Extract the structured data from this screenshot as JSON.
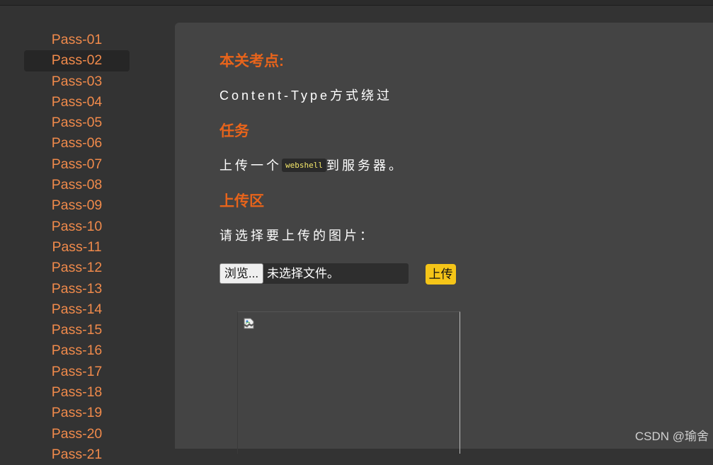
{
  "sidebar": {
    "items": [
      {
        "label": "Pass-01"
      },
      {
        "label": "Pass-02"
      },
      {
        "label": "Pass-03"
      },
      {
        "label": "Pass-04"
      },
      {
        "label": "Pass-05"
      },
      {
        "label": "Pass-06"
      },
      {
        "label": "Pass-07"
      },
      {
        "label": "Pass-08"
      },
      {
        "label": "Pass-09"
      },
      {
        "label": "Pass-10"
      },
      {
        "label": "Pass-11"
      },
      {
        "label": "Pass-12"
      },
      {
        "label": "Pass-13"
      },
      {
        "label": "Pass-14"
      },
      {
        "label": "Pass-15"
      },
      {
        "label": "Pass-16"
      },
      {
        "label": "Pass-17"
      },
      {
        "label": "Pass-18"
      },
      {
        "label": "Pass-19"
      },
      {
        "label": "Pass-20"
      },
      {
        "label": "Pass-21"
      }
    ],
    "active_label": "Pass-02"
  },
  "main": {
    "key_point_heading": "本关考点:",
    "key_point_text": "Content-Type方式绕过",
    "task_heading": "任务",
    "task_prefix": "上传一个",
    "task_code": "webshell",
    "task_suffix": "到服务器。",
    "upload_heading": "上传区",
    "upload_prompt": "请选择要上传的图片：",
    "browse_button_label": "浏览...",
    "file_status": "未选择文件。",
    "upload_button_label": "上传",
    "preview_icon": "broken-image-icon"
  },
  "watermark": "CSDN @瑜舍",
  "colors": {
    "heading": "#e8641b",
    "nav_link": "#f08a4b",
    "upload_button": "#f5c518",
    "code_text": "#f5e86a"
  }
}
